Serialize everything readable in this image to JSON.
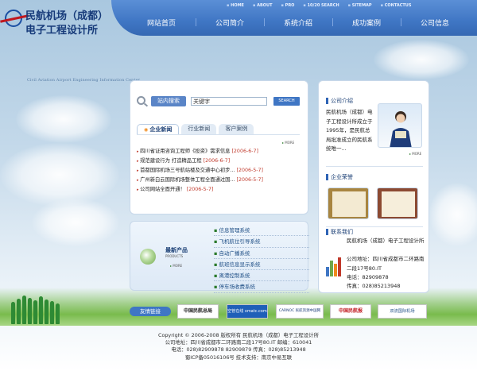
{
  "brand": {
    "line1": "民航机场（成都）",
    "line2": "电子工程设计所",
    "cert_text": "Civil Aviation Airport Engineering Information Center"
  },
  "top_links": [
    "HOME",
    "ABOUT",
    "PRO",
    "10/20 SEARCH",
    "SITEMAP",
    "CONTACTUS"
  ],
  "nav": [
    "网站首页",
    "公司简介",
    "系统介绍",
    "成功案例",
    "公司信息"
  ],
  "search": {
    "label": "站内搜索",
    "value": "关键字",
    "button": "SEARCH"
  },
  "news": {
    "tabs": [
      "企业新闻",
      "行业新闻",
      "客户案例"
    ],
    "more": "MORE",
    "items": [
      {
        "title": "四川省证用咨询工程师《投资》需求信息",
        "date": "[2006-6-7]"
      },
      {
        "title": "规范建设行为 打造精品工程",
        "date": "[2006-6-7]"
      },
      {
        "title": "首都国际机场三号航站楼及交通中心初步...",
        "date": "[2006-5-7]"
      },
      {
        "title": "广州新白云国际机场整体工程全面通过国...",
        "date": "[2006-5-7]"
      },
      {
        "title": "公司网站全面开通！",
        "date": "[2006-5-7]"
      }
    ]
  },
  "products": {
    "label": "最新产品",
    "sub": "PRODUCTS",
    "more": "MORE",
    "items": [
      "信息管理系统",
      "飞机航位引导系统",
      "自动广播系统",
      "航班信息显示系统",
      "离港控制系统",
      "停车场收费系统"
    ]
  },
  "company_intro": {
    "title": "公司介绍",
    "text": "民航机场（成都）电子工程设计所成立于1995年，是民航总局批准成立的民航系统唯一..."
  },
  "honors": {
    "title": "企业荣誉"
  },
  "contact": {
    "title": "联系我们",
    "name": "民航机场（成都）电子工程设计所",
    "address": "公司地址：四川省成都市二环路南二段17号80.IT",
    "tel": "电话：82909878",
    "fax": "传真：028)85213948"
  },
  "friend_links": {
    "label": "友情链接",
    "logos": [
      "中国民航总局",
      "空管在线 xmatc.com",
      "CARNOC 民航资源中国网",
      "中国民航报",
      "双流国际机场"
    ]
  },
  "footer": {
    "line1": "Copyright © 2006-2008 版权所有 民航机场（成都）电子工程设计所",
    "line2": "公司地址：四川省成都市二环路南二段17号80.IT 邮编：610041",
    "line3": "电话：028)82909878 82909879 传真：028)85213948",
    "line4": "蜀ICP备05016106号 技术支持：南京中易互联"
  },
  "colors": {
    "nav_band": "#3f76c4",
    "accent_red": "#c0392b",
    "link_blue": "#1f4f86"
  }
}
